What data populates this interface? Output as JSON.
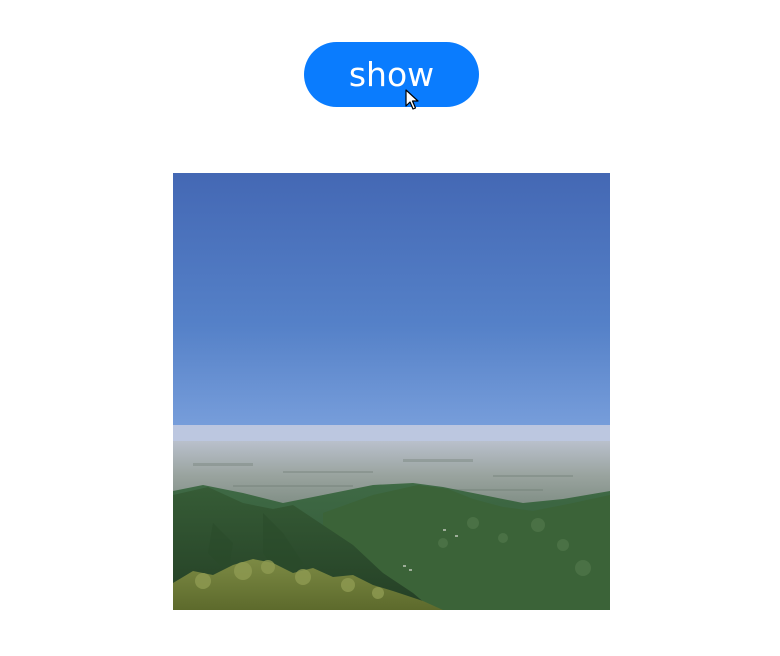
{
  "toolbar": {
    "show_label": "show"
  },
  "image": {
    "subject": "landscape-photo"
  },
  "colors": {
    "button_bg": "#0a7cfe",
    "button_text": "#ffffff",
    "page_bg": "#ffffff"
  },
  "icons": {
    "cursor": "mouse-pointer-icon"
  }
}
